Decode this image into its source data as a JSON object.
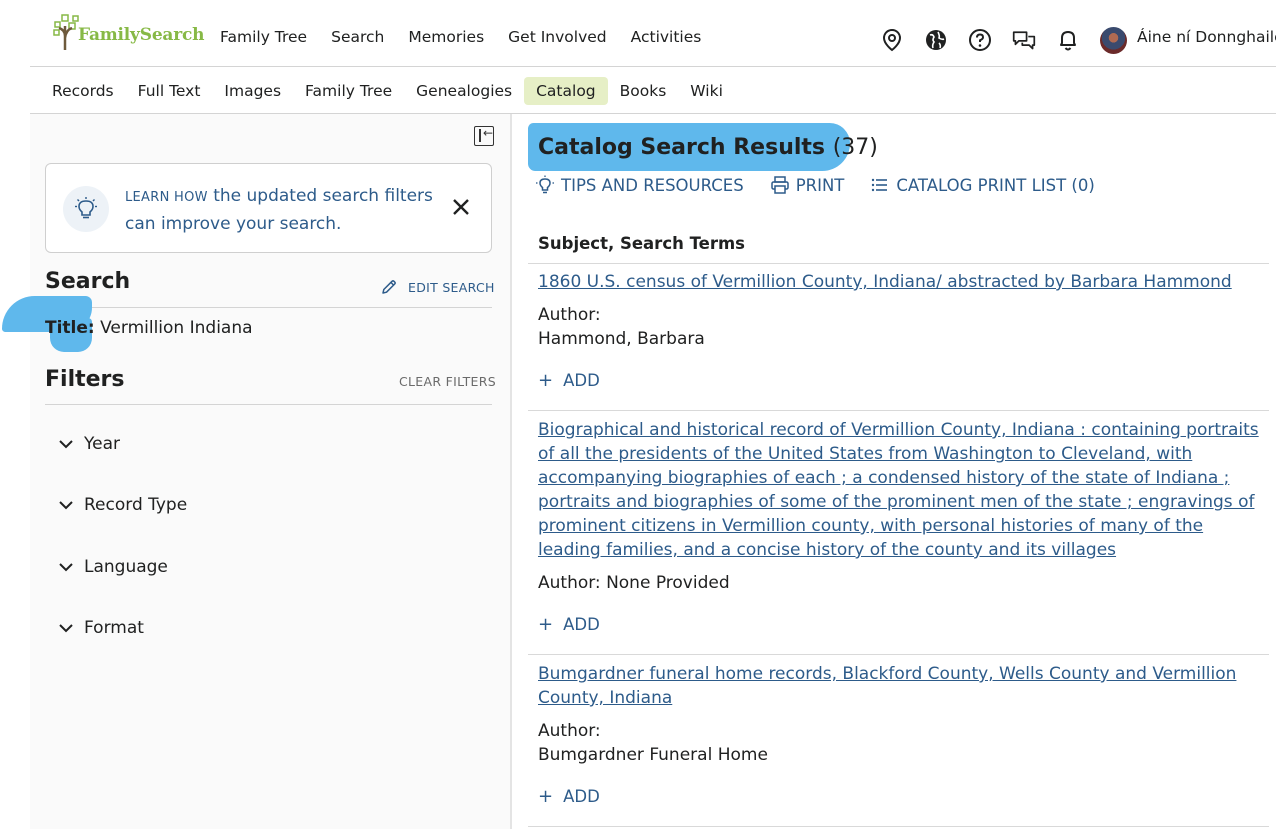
{
  "header": {
    "logo_text": "FamilySearch",
    "nav": [
      "Family Tree",
      "Search",
      "Memories",
      "Get Involved",
      "Activities"
    ],
    "icons": [
      "location-pin-icon",
      "globe-icon",
      "help-icon",
      "chat-icon",
      "bell-icon"
    ],
    "user_name": "Áine ní Donnghaile"
  },
  "secondary_nav": {
    "items": [
      "Records",
      "Full Text",
      "Images",
      "Family Tree",
      "Genealogies",
      "Catalog",
      "Books",
      "Wiki"
    ],
    "active": "Catalog"
  },
  "sidebar": {
    "learn_box": {
      "learn_how": "LEARN HOW",
      "text": " the updated search filters can improve your search."
    },
    "search_heading": "Search",
    "edit_search": "EDIT SEARCH",
    "title_label": "Title:",
    "title_value": " Vermillion Indiana",
    "filters_heading": "Filters",
    "clear_filters": "CLEAR FILTERS",
    "filters": [
      "Year",
      "Record Type",
      "Language",
      "Format"
    ]
  },
  "results": {
    "title": "Catalog Search Results",
    "count": "(37)",
    "tools": {
      "tips": "TIPS AND RESOURCES",
      "print": "PRINT",
      "print_list": "CATALOG PRINT LIST (0)"
    },
    "column_header": "Subject, Search Terms",
    "items": [
      {
        "title": "1860 U.S. census of Vermillion County, Indiana/ abstracted by Barbara Hammond",
        "author_label": "Author:",
        "author": "Hammond, Barbara",
        "add": "ADD"
      },
      {
        "title": "Biographical and historical record of Vermillion County, Indiana : containing portraits of all the presidents of the United States from Washington to Cleveland, with accompanying biographies of each ; a condensed history of the state of Indiana ; portraits and biographies of some of the prominent men of the state ; engravings of prominent citizens in Vermillion county, with personal histories of many of the leading families, and a concise history of the county and its villages",
        "author_label": "Author: None Provided",
        "author": "",
        "add": "ADD"
      },
      {
        "title": "Bumgardner funeral home records, Blackford County, Wells County and Vermillion County, Indiana",
        "author_label": "Author:",
        "author": "Bumgardner Funeral Home",
        "add": "ADD"
      }
    ]
  },
  "colors": {
    "link": "#2d5b8a",
    "brand_green": "#87b946",
    "active_tab": "#e6efc6",
    "highlight": "#5fb8ec"
  }
}
